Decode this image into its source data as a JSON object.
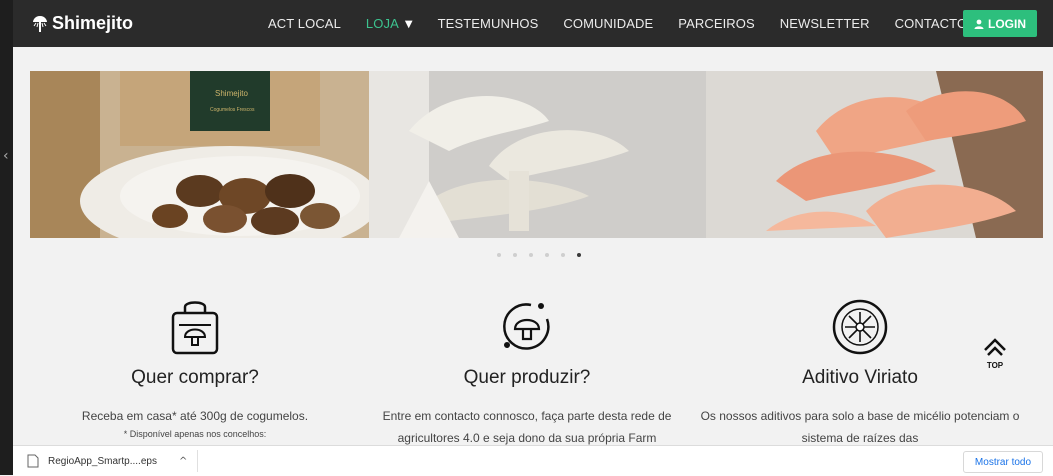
{
  "brand": {
    "name": "Shimejito"
  },
  "nav": {
    "items": [
      {
        "label": "ACT LOCAL"
      },
      {
        "label": "LOJA"
      },
      {
        "label": "TESTEMUNHOS"
      },
      {
        "label": "COMUNIDADE"
      },
      {
        "label": "PARCEIROS"
      },
      {
        "label": "NEWSLETTER"
      },
      {
        "label": "CONTACTOS"
      }
    ],
    "active": "LOJA",
    "login_label": "LOGIN",
    "accent": "#3cc38f",
    "login_color": "#2dbf7d"
  },
  "carousel": {
    "slides": [
      "shiitake-package-slide",
      "white-oyster-mushroom-slide",
      "pink-oyster-mushroom-slide"
    ],
    "dots": 6,
    "active_dot": 6
  },
  "features": [
    {
      "icon": "shopping-bag-mushroom-icon",
      "title": "Quer comprar?",
      "text": "Receba em casa* até 300g de cogumelos.",
      "note": "* Disponível apenas nos concelhos:"
    },
    {
      "icon": "grow-mushroom-icon",
      "title": "Quer produzir?",
      "text": "Entre em contacto connosco, faça parte desta rede de agricultores 4.0 e seja dono da sua própria Farm"
    },
    {
      "icon": "aditivo-viriato-seal-icon",
      "title": "Aditivo Viriato",
      "text": "Os nossos aditivos para solo a base de micélio potenciam o sistema de raízes das"
    }
  ],
  "top_button": {
    "label": "TOP"
  },
  "download_bar": {
    "file_name": "RegioApp_Smartp....eps",
    "show_all_label": "Mostrar todo"
  }
}
